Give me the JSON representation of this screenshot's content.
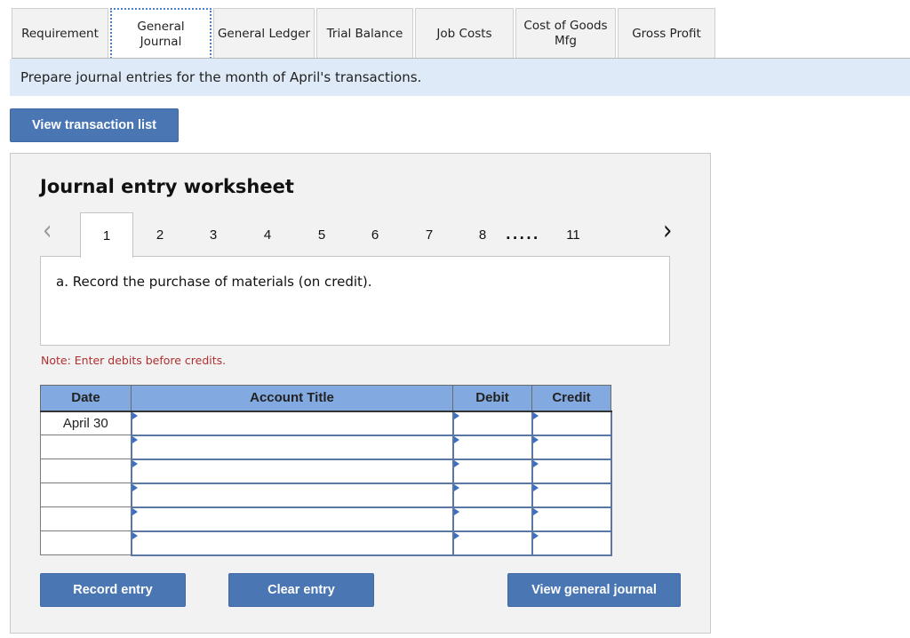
{
  "tabs": [
    {
      "label": "Requirement",
      "active": false
    },
    {
      "label": "General Journal",
      "active": true
    },
    {
      "label": "General Ledger",
      "active": false
    },
    {
      "label": "Trial Balance",
      "active": false
    },
    {
      "label": "Job Costs",
      "active": false
    },
    {
      "label": "Cost of Goods Mfg",
      "active": false
    },
    {
      "label": "Gross Profit",
      "active": false
    }
  ],
  "instruction": "Prepare journal entries for the month of April's transactions.",
  "view_transaction_list_label": "View transaction list",
  "worksheet": {
    "title": "Journal entry worksheet",
    "pager": {
      "prev_icon": "chevron-left-icon",
      "next_icon": "chevron-right-icon",
      "items": [
        "1",
        "2",
        "3",
        "4",
        "5",
        "6",
        "7",
        "8"
      ],
      "ellipsis": ".....",
      "last": "11",
      "active": "1"
    },
    "description": "a. Record the purchase of materials (on credit).",
    "note": "Note: Enter debits before credits.",
    "table": {
      "headers": {
        "date": "Date",
        "account": "Account Title",
        "debit": "Debit",
        "credit": "Credit"
      },
      "rows": [
        {
          "date": "April 30",
          "account": "",
          "debit": "",
          "credit": ""
        },
        {
          "date": "",
          "account": "",
          "debit": "",
          "credit": ""
        },
        {
          "date": "",
          "account": "",
          "debit": "",
          "credit": ""
        },
        {
          "date": "",
          "account": "",
          "debit": "",
          "credit": ""
        },
        {
          "date": "",
          "account": "",
          "debit": "",
          "credit": ""
        },
        {
          "date": "",
          "account": "",
          "debit": "",
          "credit": ""
        }
      ]
    },
    "buttons": {
      "record": "Record entry",
      "clear": "Clear entry",
      "view_general_journal": "View general journal"
    }
  },
  "colors": {
    "button": "#4a76b4",
    "banner": "#deeaf7",
    "table_header": "#82a9e0",
    "note": "#b03030"
  }
}
